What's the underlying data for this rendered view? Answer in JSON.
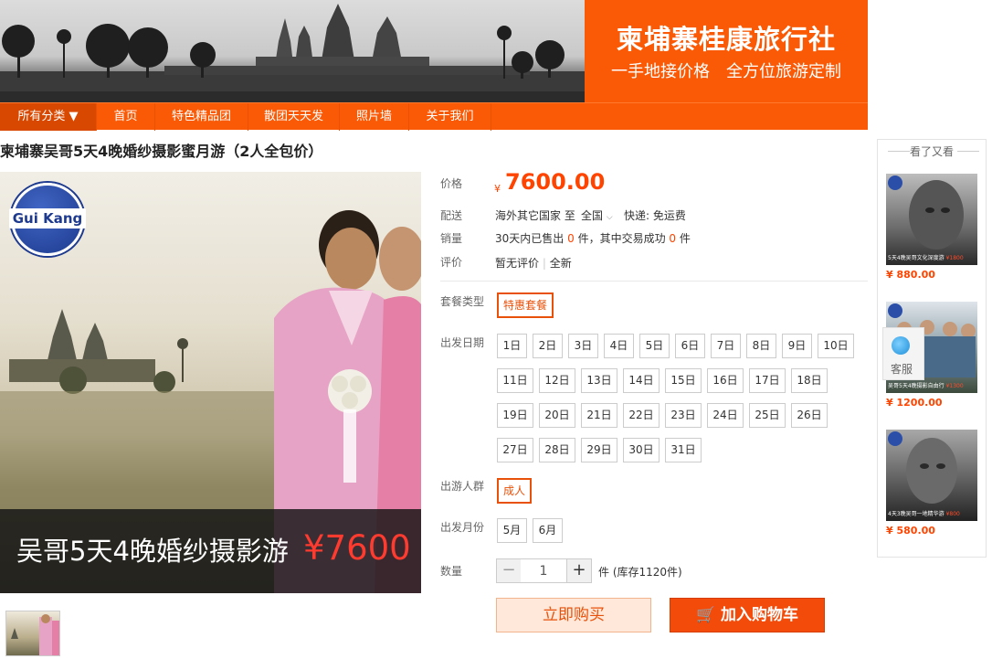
{
  "banner": {
    "brand_title": "柬埔寨桂康旅行社",
    "brand_slogan": "一手地接价格　全方位旅游定制"
  },
  "nav": {
    "items": [
      "所有分类 ▼",
      "首页",
      "特色精品团",
      "散团天天发",
      "照片墙",
      "关于我们"
    ]
  },
  "product": {
    "title": "柬埔寨吴哥5天4晚婚纱摄影蜜月游（2人全包价）",
    "logo_text": "Gui Kang",
    "caption_text": "吴哥5天4晚婚纱摄影游",
    "caption_price": "¥7600"
  },
  "details": {
    "price_label": "价格",
    "price_symbol": "¥",
    "price_value": "7600.00",
    "delivery_label": "配送",
    "delivery_from": "海外其它国家 至",
    "delivery_to": "全国",
    "delivery_express": "快递: 免运费",
    "sales_label": "销量",
    "sales_prefix": "30天内已售出",
    "sales_count": "0",
    "sales_mid": "件，其中交易成功",
    "sales_success": "0",
    "sales_suffix": "件",
    "rating_label": "评价",
    "rating_value": "暂无评价",
    "rating_new": "全新",
    "package_label": "套餐类型",
    "package_value": "特惠套餐",
    "date_label": "出发日期",
    "dates": [
      "1日",
      "2日",
      "3日",
      "4日",
      "5日",
      "6日",
      "7日",
      "8日",
      "9日",
      "10日",
      "11日",
      "12日",
      "13日",
      "14日",
      "15日",
      "16日",
      "17日",
      "18日",
      "19日",
      "20日",
      "21日",
      "22日",
      "23日",
      "24日",
      "25日",
      "26日",
      "27日",
      "28日",
      "29日",
      "30日",
      "31日"
    ],
    "crowd_label": "出游人群",
    "crowd_value": "成人",
    "month_label": "出发月份",
    "months": [
      "5月",
      "6月"
    ],
    "qty_label": "数量",
    "qty_minus": "−",
    "qty_value": "1",
    "qty_plus": "+",
    "qty_unit": "件 (库存1120件)",
    "buy_button": "立即购买",
    "cart_button": "加入购物车"
  },
  "sidebar": {
    "title": "看了又看",
    "items": [
      {
        "caption": "5天4晚吴哥文化深度游",
        "caption_price": "¥1800",
        "price": "¥ 880.00"
      },
      {
        "caption": "吴哥5天4晚摄影自由行",
        "caption_price": "¥1300",
        "price": "¥ 1200.00"
      },
      {
        "caption": "4天3晚吴哥一地精华游",
        "caption_price": "¥800",
        "price": "¥ 580.00"
      }
    ],
    "service_label": "客服"
  }
}
